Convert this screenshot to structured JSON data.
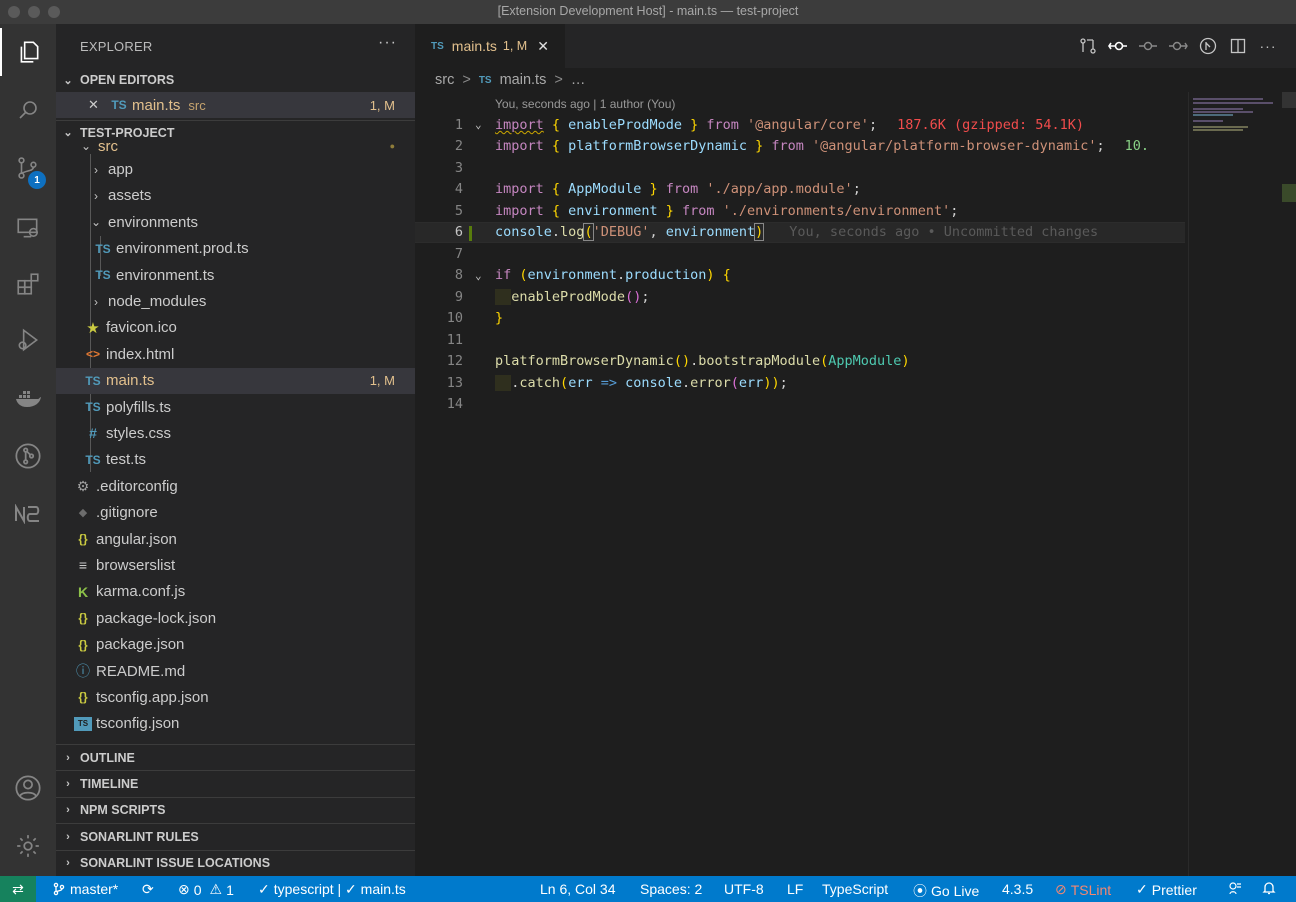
{
  "window": {
    "title": "[Extension Development Host] - main.ts — test-project"
  },
  "activity_bar": {
    "source_control_badge": "1",
    "items": [
      "explorer-icon",
      "search-icon",
      "source-control-icon",
      "remote-explorer-icon",
      "extensions-icon",
      "run-debug-icon",
      "docker-icon",
      "gitlens-icon",
      "nx-icon",
      "account-icon",
      "settings-gear-icon"
    ]
  },
  "sidebar": {
    "title": "EXPLORER",
    "more": "···",
    "open_editors": {
      "label": "OPEN EDITORS",
      "items": [
        {
          "icon": "TS",
          "name": "main.ts",
          "folder": "src",
          "status": "1, M"
        }
      ]
    },
    "project": {
      "label": "TEST-PROJECT",
      "tree": [
        {
          "name": "src",
          "type": "folder-open",
          "status_dot": "●"
        },
        {
          "name": "app",
          "type": "folder"
        },
        {
          "name": "assets",
          "type": "folder"
        },
        {
          "name": "environments",
          "type": "folder-open"
        },
        {
          "name": "environment.prod.ts",
          "icon": "TS"
        },
        {
          "name": "environment.ts",
          "icon": "TS"
        },
        {
          "name": "node_modules",
          "type": "folder"
        },
        {
          "name": "favicon.ico",
          "icon": "★"
        },
        {
          "name": "index.html",
          "icon": "<>"
        },
        {
          "name": "main.ts",
          "icon": "TS",
          "status": "1, M"
        },
        {
          "name": "polyfills.ts",
          "icon": "TS"
        },
        {
          "name": "styles.css",
          "icon": "#"
        },
        {
          "name": "test.ts",
          "icon": "TS"
        },
        {
          "name": ".editorconfig",
          "icon": "⚙"
        },
        {
          "name": ".gitignore",
          "icon": "◆"
        },
        {
          "name": "angular.json",
          "icon": "{}"
        },
        {
          "name": "browserslist",
          "icon": "≡"
        },
        {
          "name": "karma.conf.js",
          "icon": "K"
        },
        {
          "name": "package-lock.json",
          "icon": "{}"
        },
        {
          "name": "package.json",
          "icon": "{}"
        },
        {
          "name": "README.md",
          "icon": "ⓘ"
        },
        {
          "name": "tsconfig.app.json",
          "icon": "{}"
        },
        {
          "name": "tsconfig.json",
          "icon": "TS"
        }
      ]
    },
    "sections": [
      "OUTLINE",
      "TIMELINE",
      "NPM SCRIPTS",
      "SONARLINT RULES",
      "SONARLINT ISSUE LOCATIONS"
    ]
  },
  "editor": {
    "tab": {
      "icon": "TS",
      "name": "main.ts",
      "status": "1, M",
      "close": "✕"
    },
    "breadcrumb": {
      "folder": "src",
      "sep": ">",
      "icon": "TS",
      "file": "main.ts",
      "tail": "…"
    },
    "blame_header": "You, seconds ago | 1 author (You)",
    "line_numbers": [
      "1",
      "2",
      "3",
      "4",
      "5",
      "6",
      "7",
      "8",
      "9",
      "10",
      "11",
      "12",
      "13",
      "14"
    ],
    "code": {
      "l1": {
        "t1": "import",
        "t2": " { ",
        "t3": "enableProdMode",
        "t4": " } ",
        "t5": "from",
        "t6": " ",
        "t7": "'@angular/core'",
        "t8": ";",
        "size": "187.6K (gzipped: 54.1K)"
      },
      "l2": {
        "t1": "import",
        "t2": " { ",
        "t3": "platformBrowserDynamic",
        "t4": " } ",
        "t5": "from",
        "t6": " ",
        "t7": "'@angular/platform-browser-dynamic'",
        "t8": ";",
        "size": "10."
      },
      "l4": {
        "t1": "import",
        "t2": " { ",
        "t3": "AppModule",
        "t4": " } ",
        "t5": "from",
        "t6": " ",
        "t7": "'./app/app.module'",
        "t8": ";"
      },
      "l5": {
        "t1": "import",
        "t2": " { ",
        "t3": "environment",
        "t4": " } ",
        "t5": "from",
        "t6": " ",
        "t7": "'./environments/environment'",
        "t8": ";"
      },
      "l6": {
        "t1": "console",
        "t2": ".",
        "t3": "log",
        "t4": "(",
        "t5": "'DEBUG'",
        "t6": ", ",
        "t7": "environment",
        "t8": ")",
        "blame": "You, seconds ago • Uncommitted changes"
      },
      "l8": {
        "t1": "if",
        "t2": " ",
        "t3": "(",
        "t4": "environment",
        "t5": ".",
        "t6": "production",
        "t7": ")",
        "t8": " ",
        "t9": "{"
      },
      "l9": {
        "t1": "  ",
        "t2": "enableProdMode",
        "t3": "()",
        "t4": ";"
      },
      "l10": {
        "t1": "}"
      },
      "l12": {
        "t1": "platformBrowserDynamic",
        "t2": "()",
        "t3": ".",
        "t4": "bootstrapModule",
        "t5": "(",
        "t6": "AppModule",
        "t7": ")"
      },
      "l13": {
        "t1": "  ",
        "t2": ".",
        "t3": "catch",
        "t4": "(",
        "t5": "err",
        "t6": " => ",
        "t7": "console",
        "t8": ".",
        "t9": "error",
        "t10": "(",
        "t11": "err",
        "t12": "))",
        "t13": ";"
      }
    }
  },
  "statusbar": {
    "remote": "⇄",
    "branch": "master*",
    "sync": "⟳",
    "errors": "0",
    "warnings": "1",
    "ts_status": "typescript | ✓ main.ts",
    "position": "Ln 6, Col 34",
    "spaces": "Spaces: 2",
    "encoding": "UTF-8",
    "eol": "LF",
    "language": "TypeScript",
    "go_live": "Go Live",
    "ts_version": "4.3.5",
    "tslint": "TSLint",
    "prettier": "Prettier"
  },
  "colors": {
    "accent": "#007acc",
    "modified": "#e2c08d",
    "remote": "#16825d"
  }
}
